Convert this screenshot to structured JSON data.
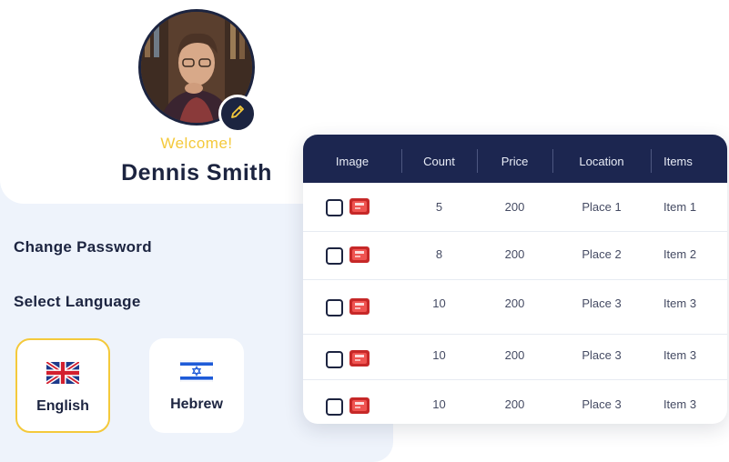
{
  "profile": {
    "welcome": "Welcome!",
    "name": "Dennis Smith"
  },
  "menu": {
    "change_password": "Change Password",
    "select_language": "Select Language"
  },
  "languages": [
    {
      "label": "English",
      "flag": "uk-flag-icon",
      "selected": true
    },
    {
      "label": "Hebrew",
      "flag": "israel-flag-icon",
      "selected": false
    }
  ],
  "table": {
    "headers": [
      "Image",
      "Count",
      "Price",
      "Location",
      "Items"
    ],
    "rows": [
      {
        "count": "5",
        "price": "200",
        "location": "Place 1",
        "item": "Item 1"
      },
      {
        "count": "8",
        "price": "200",
        "location": "Place 2",
        "item": "Item 2"
      },
      {
        "count": "10",
        "price": "200",
        "location": "Place 3",
        "item": "Item 3"
      },
      {
        "count": "10",
        "price": "200",
        "location": "Place 3",
        "item": "Item 3"
      },
      {
        "count": "10",
        "price": "200",
        "location": "Place 3",
        "item": "Item 3"
      }
    ]
  },
  "colors": {
    "navy": "#1c2650",
    "accent_yellow": "#f4c93b",
    "panel_bg": "#eef3fb"
  }
}
